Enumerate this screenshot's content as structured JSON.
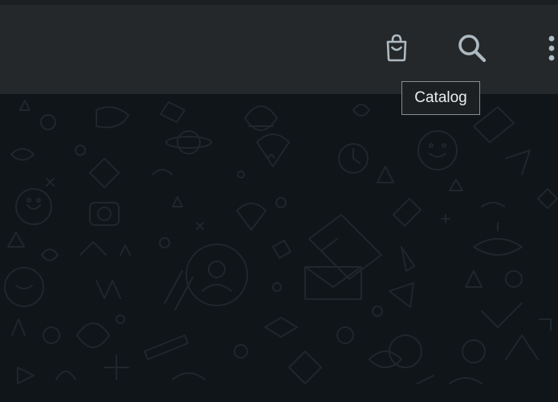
{
  "header": {
    "icons": {
      "catalog": "shopping-bag-icon",
      "search": "search-icon",
      "menu": "more-vertical-icon"
    }
  },
  "tooltip": {
    "text": "Catalog"
  },
  "colors": {
    "header_bg": "#25282b",
    "chat_bg": "#0f1519",
    "icon": "#aebac1",
    "doodle": "#1e262b"
  }
}
